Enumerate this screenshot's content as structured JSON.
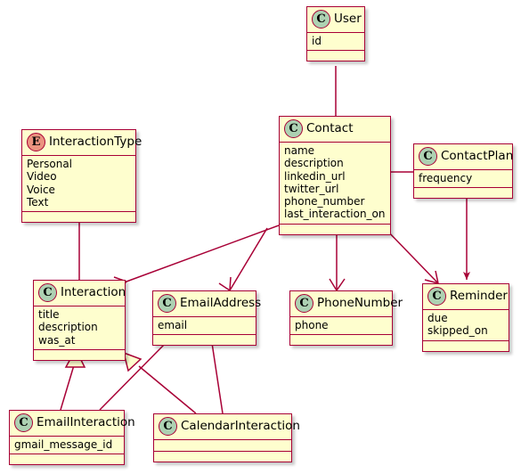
{
  "diagram": {
    "title": "UML class diagram",
    "background": "#FFFFFF",
    "line_color": "#A80036",
    "node_fill": "#FEFECE",
    "class_icon_fill": "#ADD1B2",
    "enum_icon_fill": "#EB937F",
    "class_icon_letter": "C",
    "enum_icon_letter": "E"
  },
  "nodes": {
    "user": {
      "name": "User",
      "icon": "class-icon",
      "icon_letter": "C",
      "attributes": [
        "id"
      ]
    },
    "contact": {
      "name": "Contact",
      "icon": "class-icon",
      "icon_letter": "C",
      "attributes": [
        "name",
        "description",
        "linkedin_url",
        "twitter_url",
        "phone_number",
        "last_interaction_on"
      ]
    },
    "interactiontype": {
      "name": "InteractionType",
      "icon": "enum-icon",
      "icon_letter": "E",
      "attributes": [
        "Personal",
        "Video",
        "Voice",
        "Text"
      ]
    },
    "contactplan": {
      "name": "ContactPlan",
      "icon": "class-icon",
      "icon_letter": "C",
      "attributes": [
        "frequency"
      ]
    },
    "interaction": {
      "name": "Interaction",
      "icon": "class-icon",
      "icon_letter": "C",
      "attributes": [
        "title",
        "description",
        "was_at"
      ]
    },
    "emailaddress": {
      "name": "EmailAddress",
      "icon": "class-icon",
      "icon_letter": "C",
      "attributes": [
        "email"
      ]
    },
    "phonenumber": {
      "name": "PhoneNumber",
      "icon": "class-icon",
      "icon_letter": "C",
      "attributes": [
        "phone"
      ]
    },
    "reminder": {
      "name": "Reminder",
      "icon": "class-icon",
      "icon_letter": "C",
      "attributes": [
        "due",
        "skipped_on"
      ]
    },
    "emailinteraction": {
      "name": "EmailInteraction",
      "icon": "class-icon",
      "icon_letter": "C",
      "attributes": [
        "gmail_message_id"
      ]
    },
    "calendarinteraction": {
      "name": "CalendarInteraction",
      "icon": "class-icon",
      "icon_letter": "C",
      "attributes": []
    }
  },
  "edges": [
    {
      "from": "user",
      "to": "contact",
      "style": "association",
      "arrow": "none"
    },
    {
      "from": "interactiontype",
      "to": "interaction",
      "style": "association",
      "arrow": "none"
    },
    {
      "from": "contact",
      "to": "contactplan",
      "style": "association",
      "arrow": "none"
    },
    {
      "from": "contact",
      "to": "interaction",
      "style": "association",
      "arrow": "open"
    },
    {
      "from": "contact",
      "to": "emailaddress",
      "style": "association",
      "arrow": "open"
    },
    {
      "from": "contact",
      "to": "phonenumber",
      "style": "association",
      "arrow": "open"
    },
    {
      "from": "contact",
      "to": "reminder",
      "style": "association",
      "arrow": "open"
    },
    {
      "from": "contactplan",
      "to": "reminder",
      "style": "association",
      "arrow": "filled"
    },
    {
      "from": "emailinteraction",
      "to": "interaction",
      "style": "inheritance",
      "arrow": "hollow-triangle"
    },
    {
      "from": "calendarinteraction",
      "to": "interaction",
      "style": "inheritance",
      "arrow": "hollow-triangle"
    },
    {
      "from": "emailaddress",
      "to": "emailinteraction",
      "style": "association",
      "arrow": "none"
    },
    {
      "from": "emailaddress",
      "to": "calendarinteraction",
      "style": "association",
      "arrow": "none"
    }
  ]
}
